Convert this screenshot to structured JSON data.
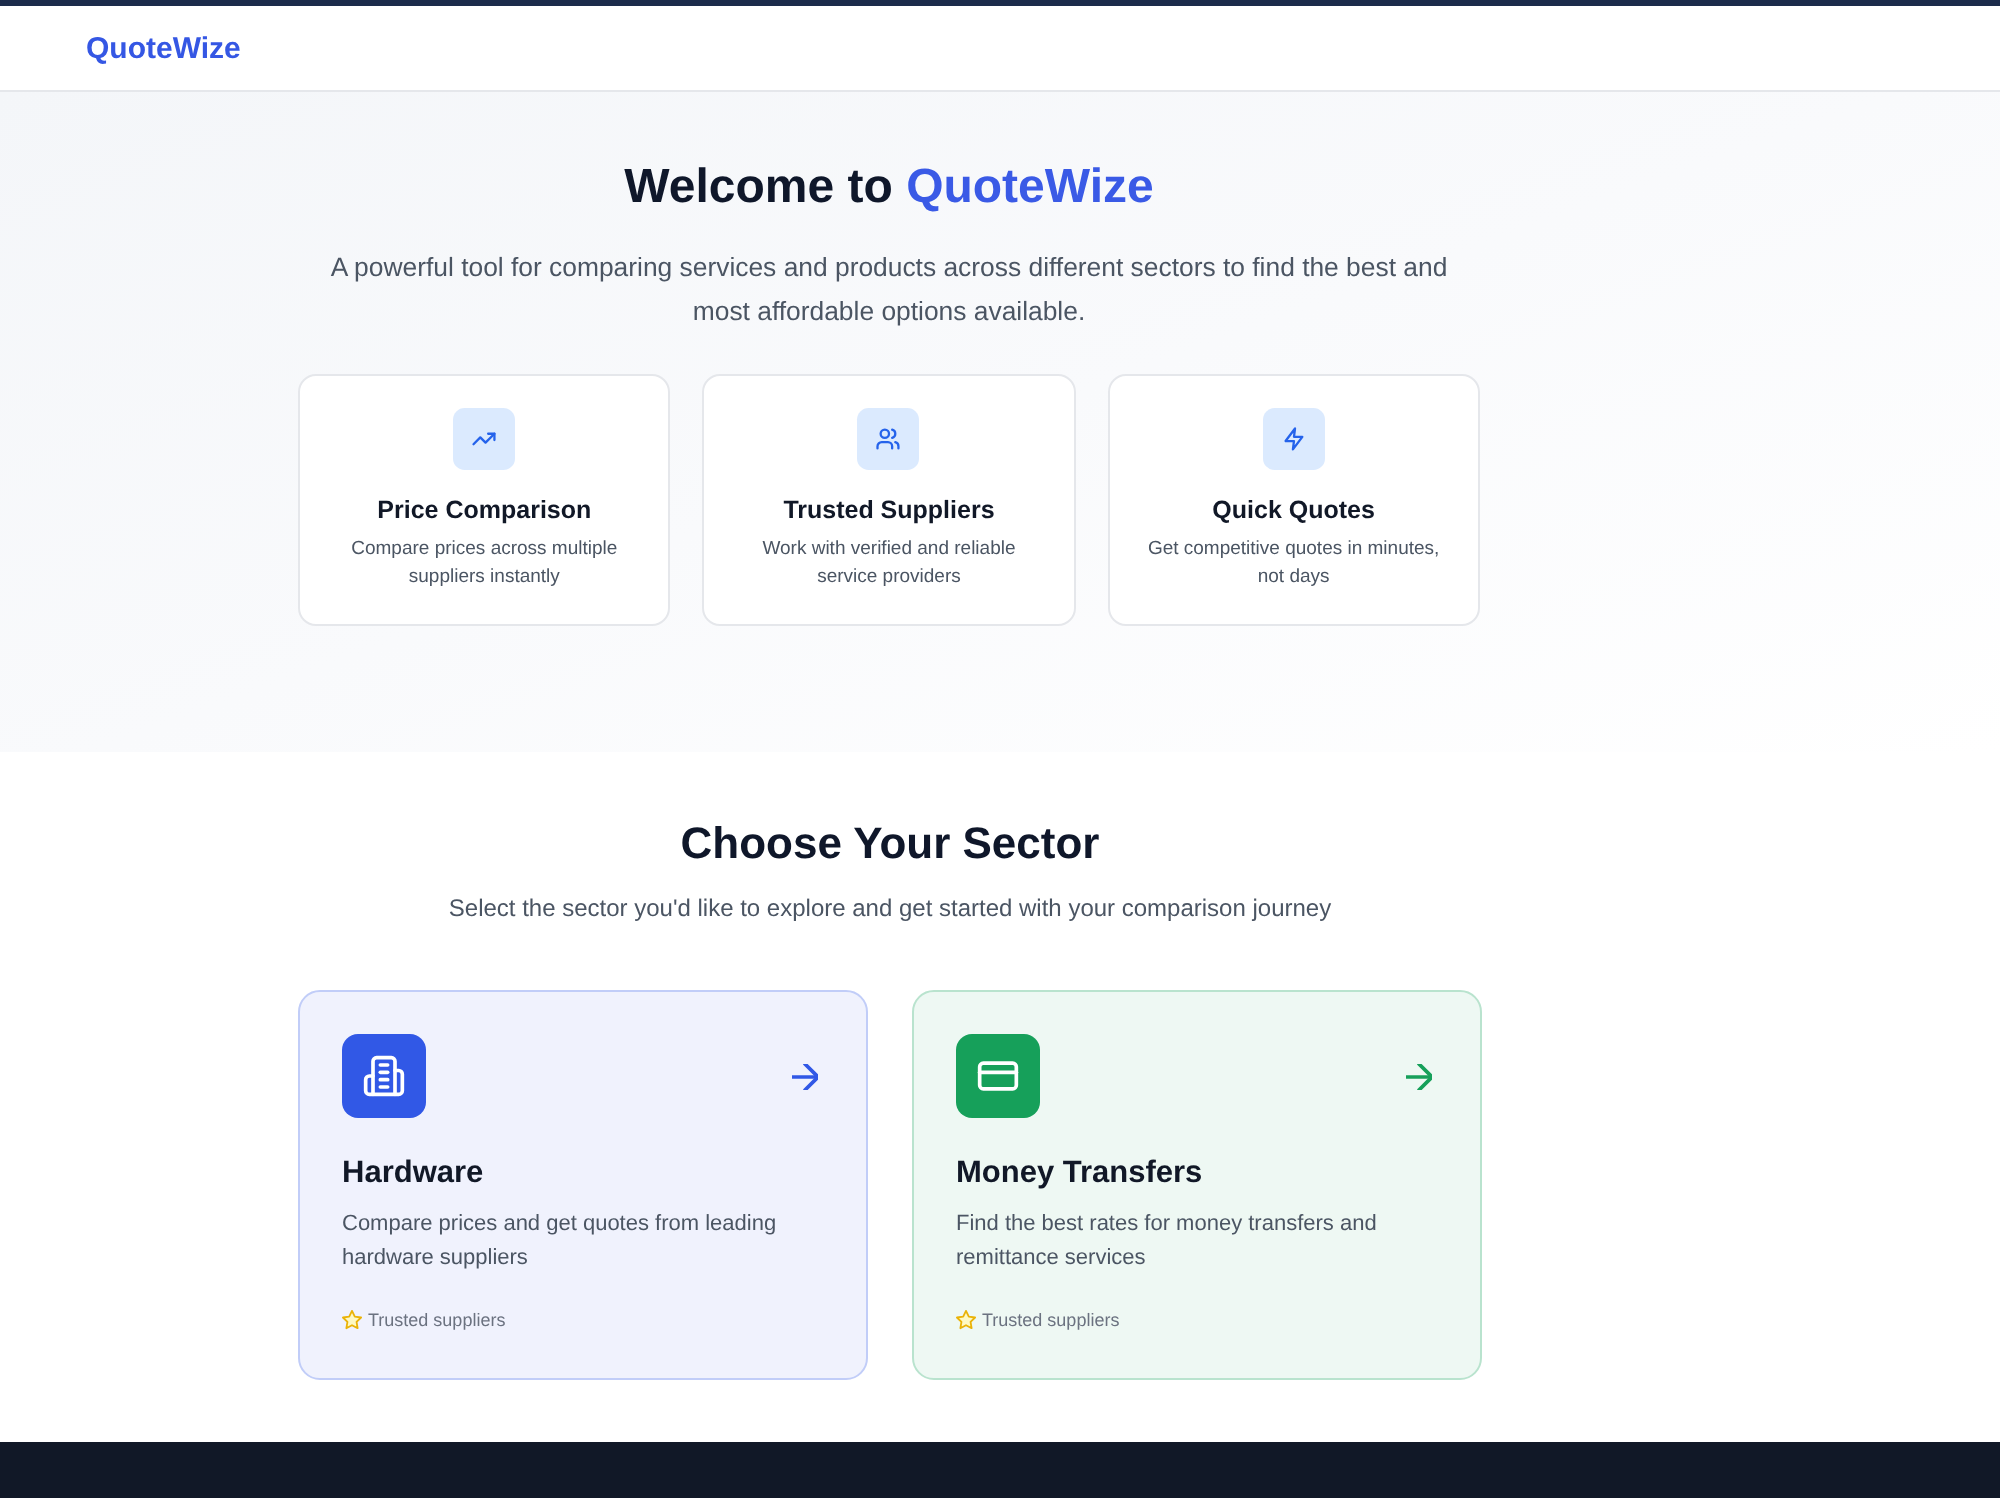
{
  "header": {
    "logo": "QuoteWize"
  },
  "hero": {
    "title": "Welcome to",
    "title_highlight": "QuoteWize",
    "subtitle": "A powerful tool for comparing services and products across different sectors to find the best and most affordable options available.",
    "features": [
      {
        "title": "Price Comparison",
        "description": "Compare prices across multiple suppliers instantly"
      },
      {
        "title": "Trusted Suppliers",
        "description": "Work with verified and reliable service providers"
      },
      {
        "title": "Quick Quotes",
        "description": "Get competitive quotes in minutes, not days"
      }
    ]
  },
  "sectors": {
    "title": "Choose Your Sector",
    "subtitle": "Select the sector you'd like to explore and get started with your comparison journey",
    "cards": [
      {
        "title": "Hardware",
        "description": "Compare prices and get quotes from leading hardware suppliers",
        "badge": "Trusted suppliers",
        "color": "#3158e6"
      },
      {
        "title": "Money Transfers",
        "description": "Find the best rates for money transfers and remittance services",
        "badge": "Trusted suppliers",
        "color": "#16a05a"
      }
    ]
  }
}
